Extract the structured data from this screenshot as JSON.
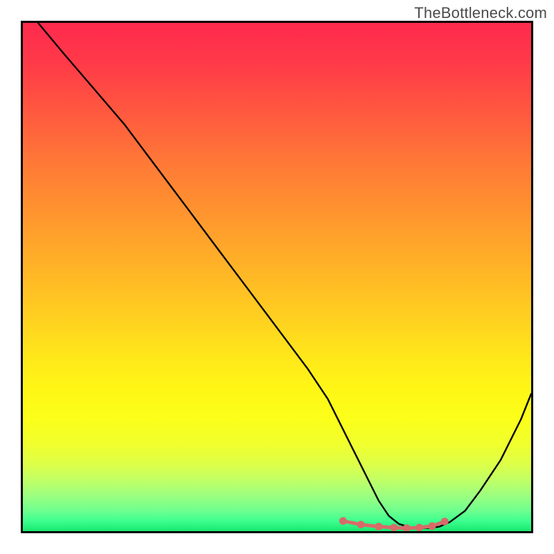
{
  "watermark": "TheBottleneck.com",
  "chart_data": {
    "type": "line",
    "title": "",
    "xlabel": "",
    "ylabel": "",
    "xlim": [
      0,
      100
    ],
    "ylim": [
      0,
      100
    ],
    "grid": false,
    "x": [
      3,
      8,
      14,
      20,
      26,
      32,
      38,
      44,
      50,
      56,
      60,
      63,
      66,
      68,
      70,
      72,
      74,
      76,
      78,
      80,
      82,
      84,
      87,
      90,
      94,
      98,
      100
    ],
    "values": [
      100,
      94,
      87,
      80,
      72,
      64,
      56,
      48,
      40,
      32,
      26,
      20,
      14,
      10,
      6,
      3,
      1.4,
      0.8,
      0.6,
      0.6,
      0.9,
      1.8,
      4,
      8,
      14,
      22,
      27
    ],
    "marker_points_x": [
      63,
      66.5,
      70,
      73,
      75.5,
      78,
      80.5,
      83
    ],
    "marker_points_y": [
      2.0,
      1.3,
      0.9,
      0.7,
      0.6,
      0.7,
      1.0,
      1.9
    ],
    "marker_color": "#d86a6a",
    "line_color": "#000000",
    "gradient_stops": [
      {
        "pos": 0.0,
        "color": "#ff2a4d"
      },
      {
        "pos": 0.35,
        "color": "#ff8a30"
      },
      {
        "pos": 0.7,
        "color": "#fff018"
      },
      {
        "pos": 0.9,
        "color": "#b8ff60"
      },
      {
        "pos": 1.0,
        "color": "#17e86e"
      }
    ]
  }
}
